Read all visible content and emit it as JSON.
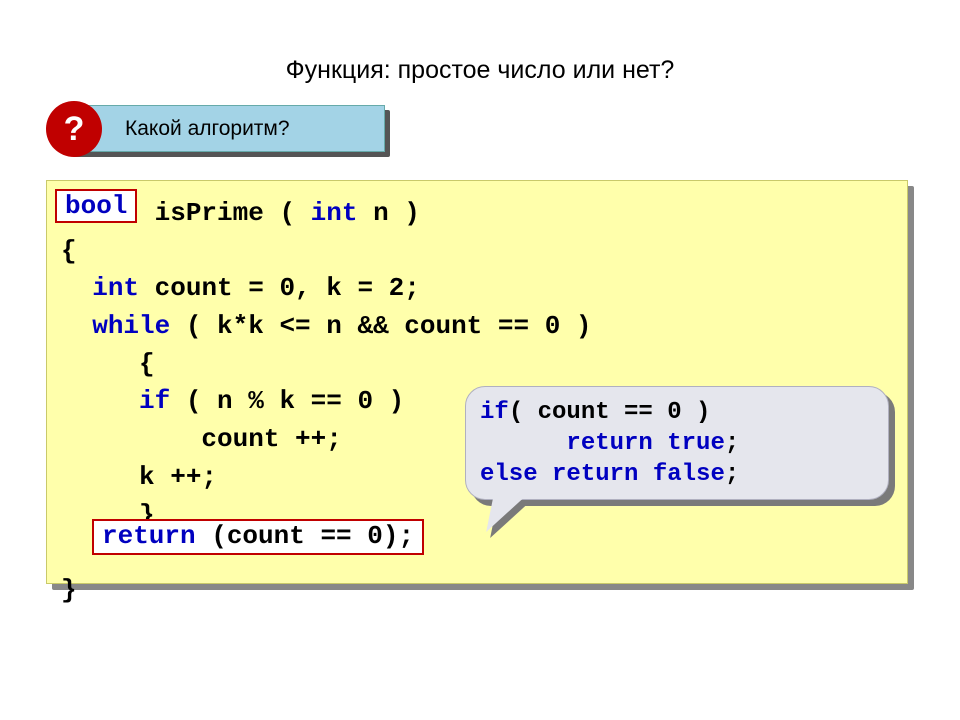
{
  "title": "Функция: простое число или нет?",
  "question": {
    "symbol": "?",
    "text": "Какой алгоритм?"
  },
  "code": {
    "bool_badge": "bool",
    "line1_prefix": "     ",
    "line1_func": " isPrime ( ",
    "line1_int": "int",
    "line1_rest": " n )",
    "line2": "{",
    "line3_indent": "  ",
    "line3_int": "int",
    "line3_rest": " count = 0, k = 2;",
    "line4_indent": "  ",
    "line4_while": "while",
    "line4_rest": " ( k*k <= n && count == 0 )",
    "line5": "     {",
    "line6_indent": "     ",
    "line6_if": "if",
    "line6_rest": " ( n % k == 0 )",
    "line7": "         count ++;",
    "line8": "     k ++;",
    "line9": "     }",
    "line10_blank": " ",
    "line11": "}"
  },
  "return_box": {
    "return_kw": "return",
    "rest": " (count == 0);"
  },
  "callout": {
    "l1_if": "if",
    "l1_rest": "( count == 0 )",
    "l2_indent": "      ",
    "l2_return": "return",
    "l2_true": "true",
    "l2_semi": ";",
    "l3_else": "else",
    "l3_return": "return",
    "l3_false": "false",
    "l3_semi": ";"
  }
}
